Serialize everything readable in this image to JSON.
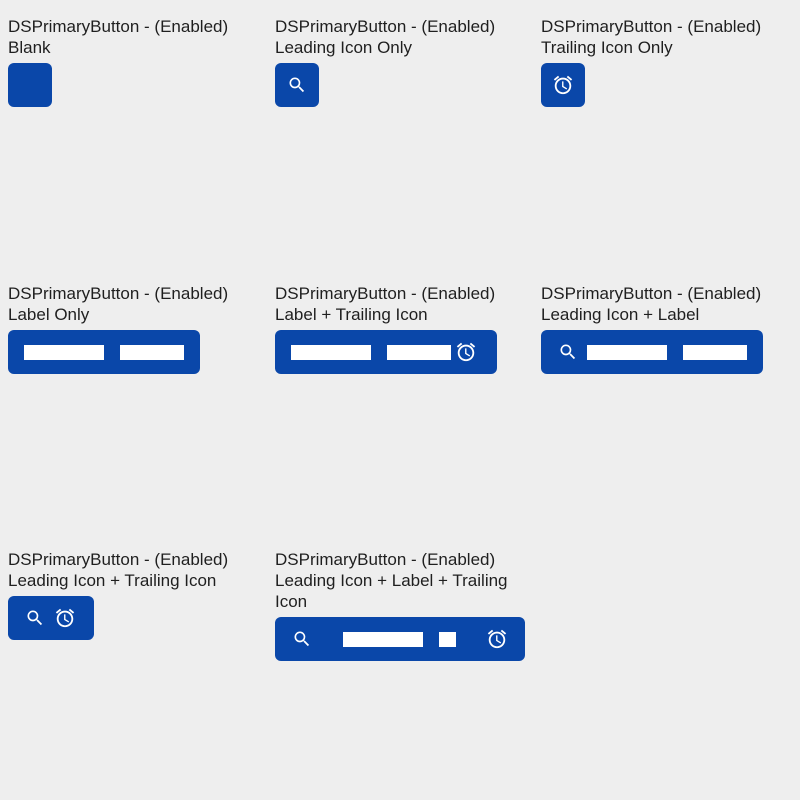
{
  "buttons": [
    {
      "caption_line1": "DSPrimaryButton - (Enabled)",
      "caption_line2": "Blank",
      "icons": []
    },
    {
      "caption_line1": "DSPrimaryButton - (Enabled)",
      "caption_line2": "Leading Icon Only",
      "icons": [
        "search-icon"
      ]
    },
    {
      "caption_line1": "DSPrimaryButton - (Enabled)",
      "caption_line2": "Trailing Icon Only",
      "icons": [
        "alarm-clock-icon"
      ]
    },
    {
      "caption_line1": "DSPrimaryButton - (Enabled)",
      "caption_line2": "Label Only",
      "icons": []
    },
    {
      "caption_line1": "DSPrimaryButton - (Enabled)",
      "caption_line2": "Label + Trailing Icon",
      "icons": [
        "alarm-clock-icon"
      ]
    },
    {
      "caption_line1": "DSPrimaryButton - (Enabled)",
      "caption_line2": "Leading Icon + Label",
      "icons": [
        "search-icon"
      ]
    },
    {
      "caption_line1": "DSPrimaryButton - (Enabled)",
      "caption_line2": "Leading Icon + Trailing Icon",
      "icons": [
        "search-icon",
        "alarm-clock-icon"
      ]
    },
    {
      "caption_line1": "DSPrimaryButton - (Enabled)",
      "caption_line2": "Leading Icon + Label + Trailing",
      "caption_line3": "Icon",
      "icons": [
        "search-icon",
        "alarm-clock-icon"
      ]
    }
  ],
  "colors": {
    "background": "#eeeeee",
    "button_primary": "#0a47a9",
    "button_content": "#ffffff",
    "caption_text": "#1f1f1f"
  }
}
